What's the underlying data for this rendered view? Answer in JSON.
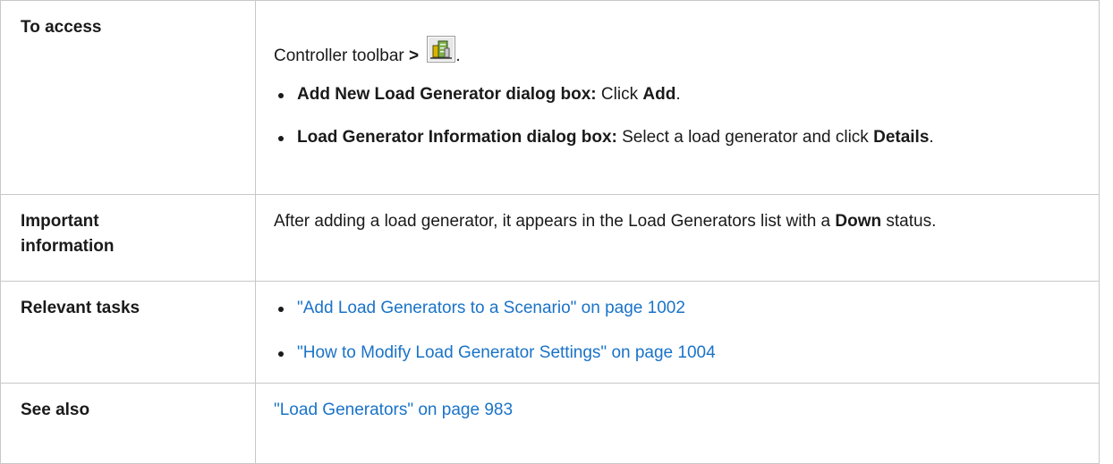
{
  "rows": {
    "access": {
      "label": "To access",
      "intro": "Controller toolbar",
      "separator": ">",
      "items": [
        {
          "bold": "Add New Load Generator dialog box:",
          "text1": " Click ",
          "bold2": "Add",
          "text2": "."
        },
        {
          "bold": "Load Generator Information dialog box:",
          "text1": " Select a load generator and click ",
          "bold2": "Details",
          "text2": "."
        }
      ],
      "icon": "load-generators-toolbar-icon"
    },
    "important": {
      "label_line1": "Important",
      "label_line2": "information",
      "text1": "After adding a load generator, it appears in the Load Generators list with a ",
      "bold": "Down",
      "text2": " status."
    },
    "tasks": {
      "label": "Relevant tasks",
      "links": [
        "\"Add Load Generators to a Scenario\" on page 1002",
        "\"How to Modify Load Generator Settings\" on page 1004"
      ]
    },
    "see_also": {
      "label": "See also",
      "link": "\"Load Generators\" on page 983"
    }
  },
  "colors": {
    "link": "#1a73c8",
    "border": "#c8c8c8",
    "text": "#1a1a1a"
  }
}
